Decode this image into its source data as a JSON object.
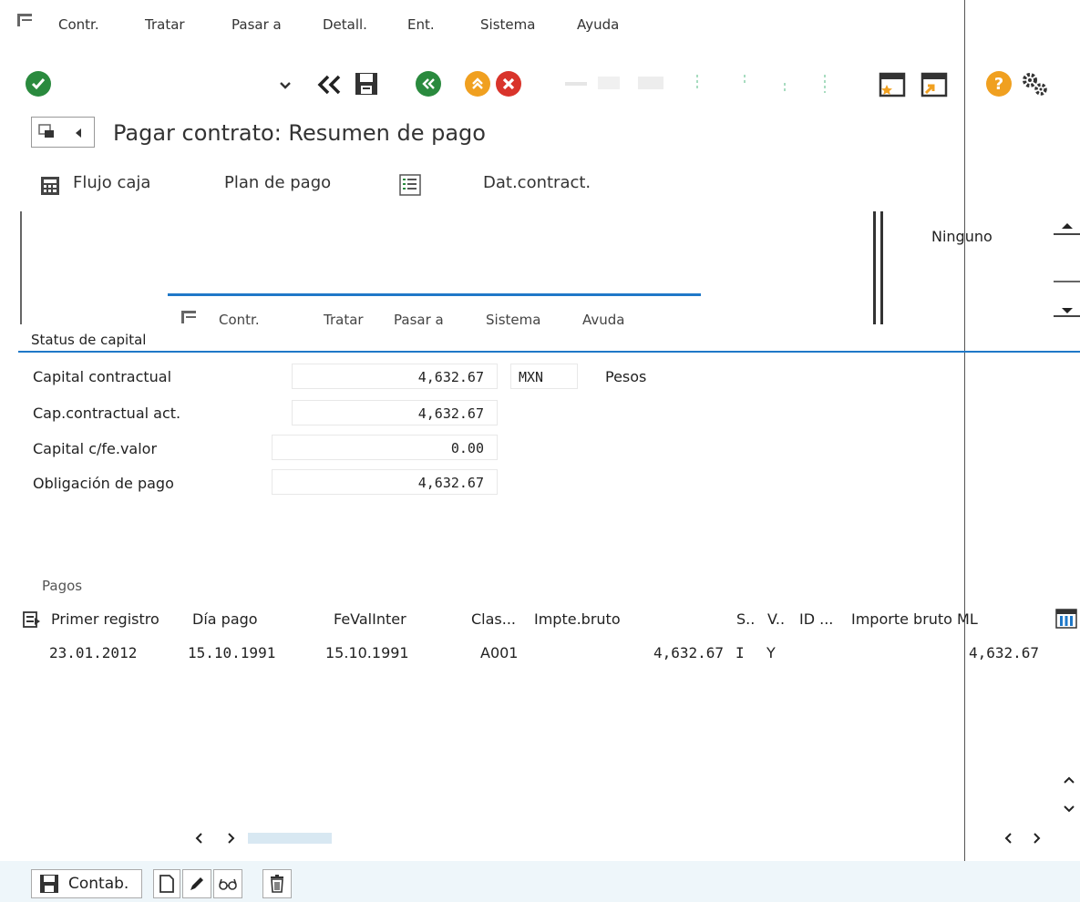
{
  "menu": {
    "items": [
      "Contr.",
      "Tratar",
      "Pasar a",
      "Detall.",
      "Ent.",
      "Sistema",
      "Ayuda"
    ]
  },
  "toolbar": {
    "command_field": "",
    "icons": [
      "enter-icon",
      "dropdown-icon",
      "back-history-icon",
      "save-icon",
      "back-icon",
      "exit-icon",
      "cancel-icon",
      "new-session-icon",
      "shortcut-icon",
      "help-icon",
      "settings-icon"
    ]
  },
  "header": {
    "title": "Pagar contrato: Resumen de pago"
  },
  "app_toolbar": {
    "cashflow_label": "Flujo caja",
    "payment_plan_label": "Plan de pago",
    "contract_data_label": "Dat.contract."
  },
  "side_panel": {
    "selection_value": "Ninguno"
  },
  "popup_menu": {
    "items": [
      "Contr.",
      "Tratar",
      "Pasar a",
      "Sistema",
      "Avuda"
    ]
  },
  "capital_status": {
    "section_title": "Status de capital",
    "rows": [
      {
        "label": "Capital contractual",
        "value": "4,632.67",
        "currency": "MXN",
        "currency_text": "Pesos"
      },
      {
        "label": "Cap.contractual act.",
        "value": "4,632.67"
      },
      {
        "label": "Capital c/fe.valor",
        "value": "0.00"
      },
      {
        "label": "Obligación de pago",
        "value": "4,632.67"
      }
    ]
  },
  "payments": {
    "section_title": "Pagos",
    "columns": [
      "Primer registro",
      "Día pago",
      "FeValInter",
      "Clas...",
      "Impte.bruto",
      "S..",
      "V..",
      "ID ...",
      "Importe bruto ML"
    ],
    "rows": [
      {
        "primer_registro": "23.01.2012",
        "dia_pago": "15.10.1991",
        "fevalinter": "15.10.1991",
        "clase": "A001",
        "impte_bruto": "4,632.67",
        "s": "I",
        "v": "Y",
        "id": "",
        "importe_ml": "4,632.67"
      }
    ]
  },
  "bottom_toolbar": {
    "post_label": "Contab."
  },
  "colors": {
    "accent_blue": "#1f78c8",
    "green": "#2a8a3e",
    "orange": "#f0a020",
    "red": "#d9342b",
    "bottom_bar": "#eef6fa"
  }
}
